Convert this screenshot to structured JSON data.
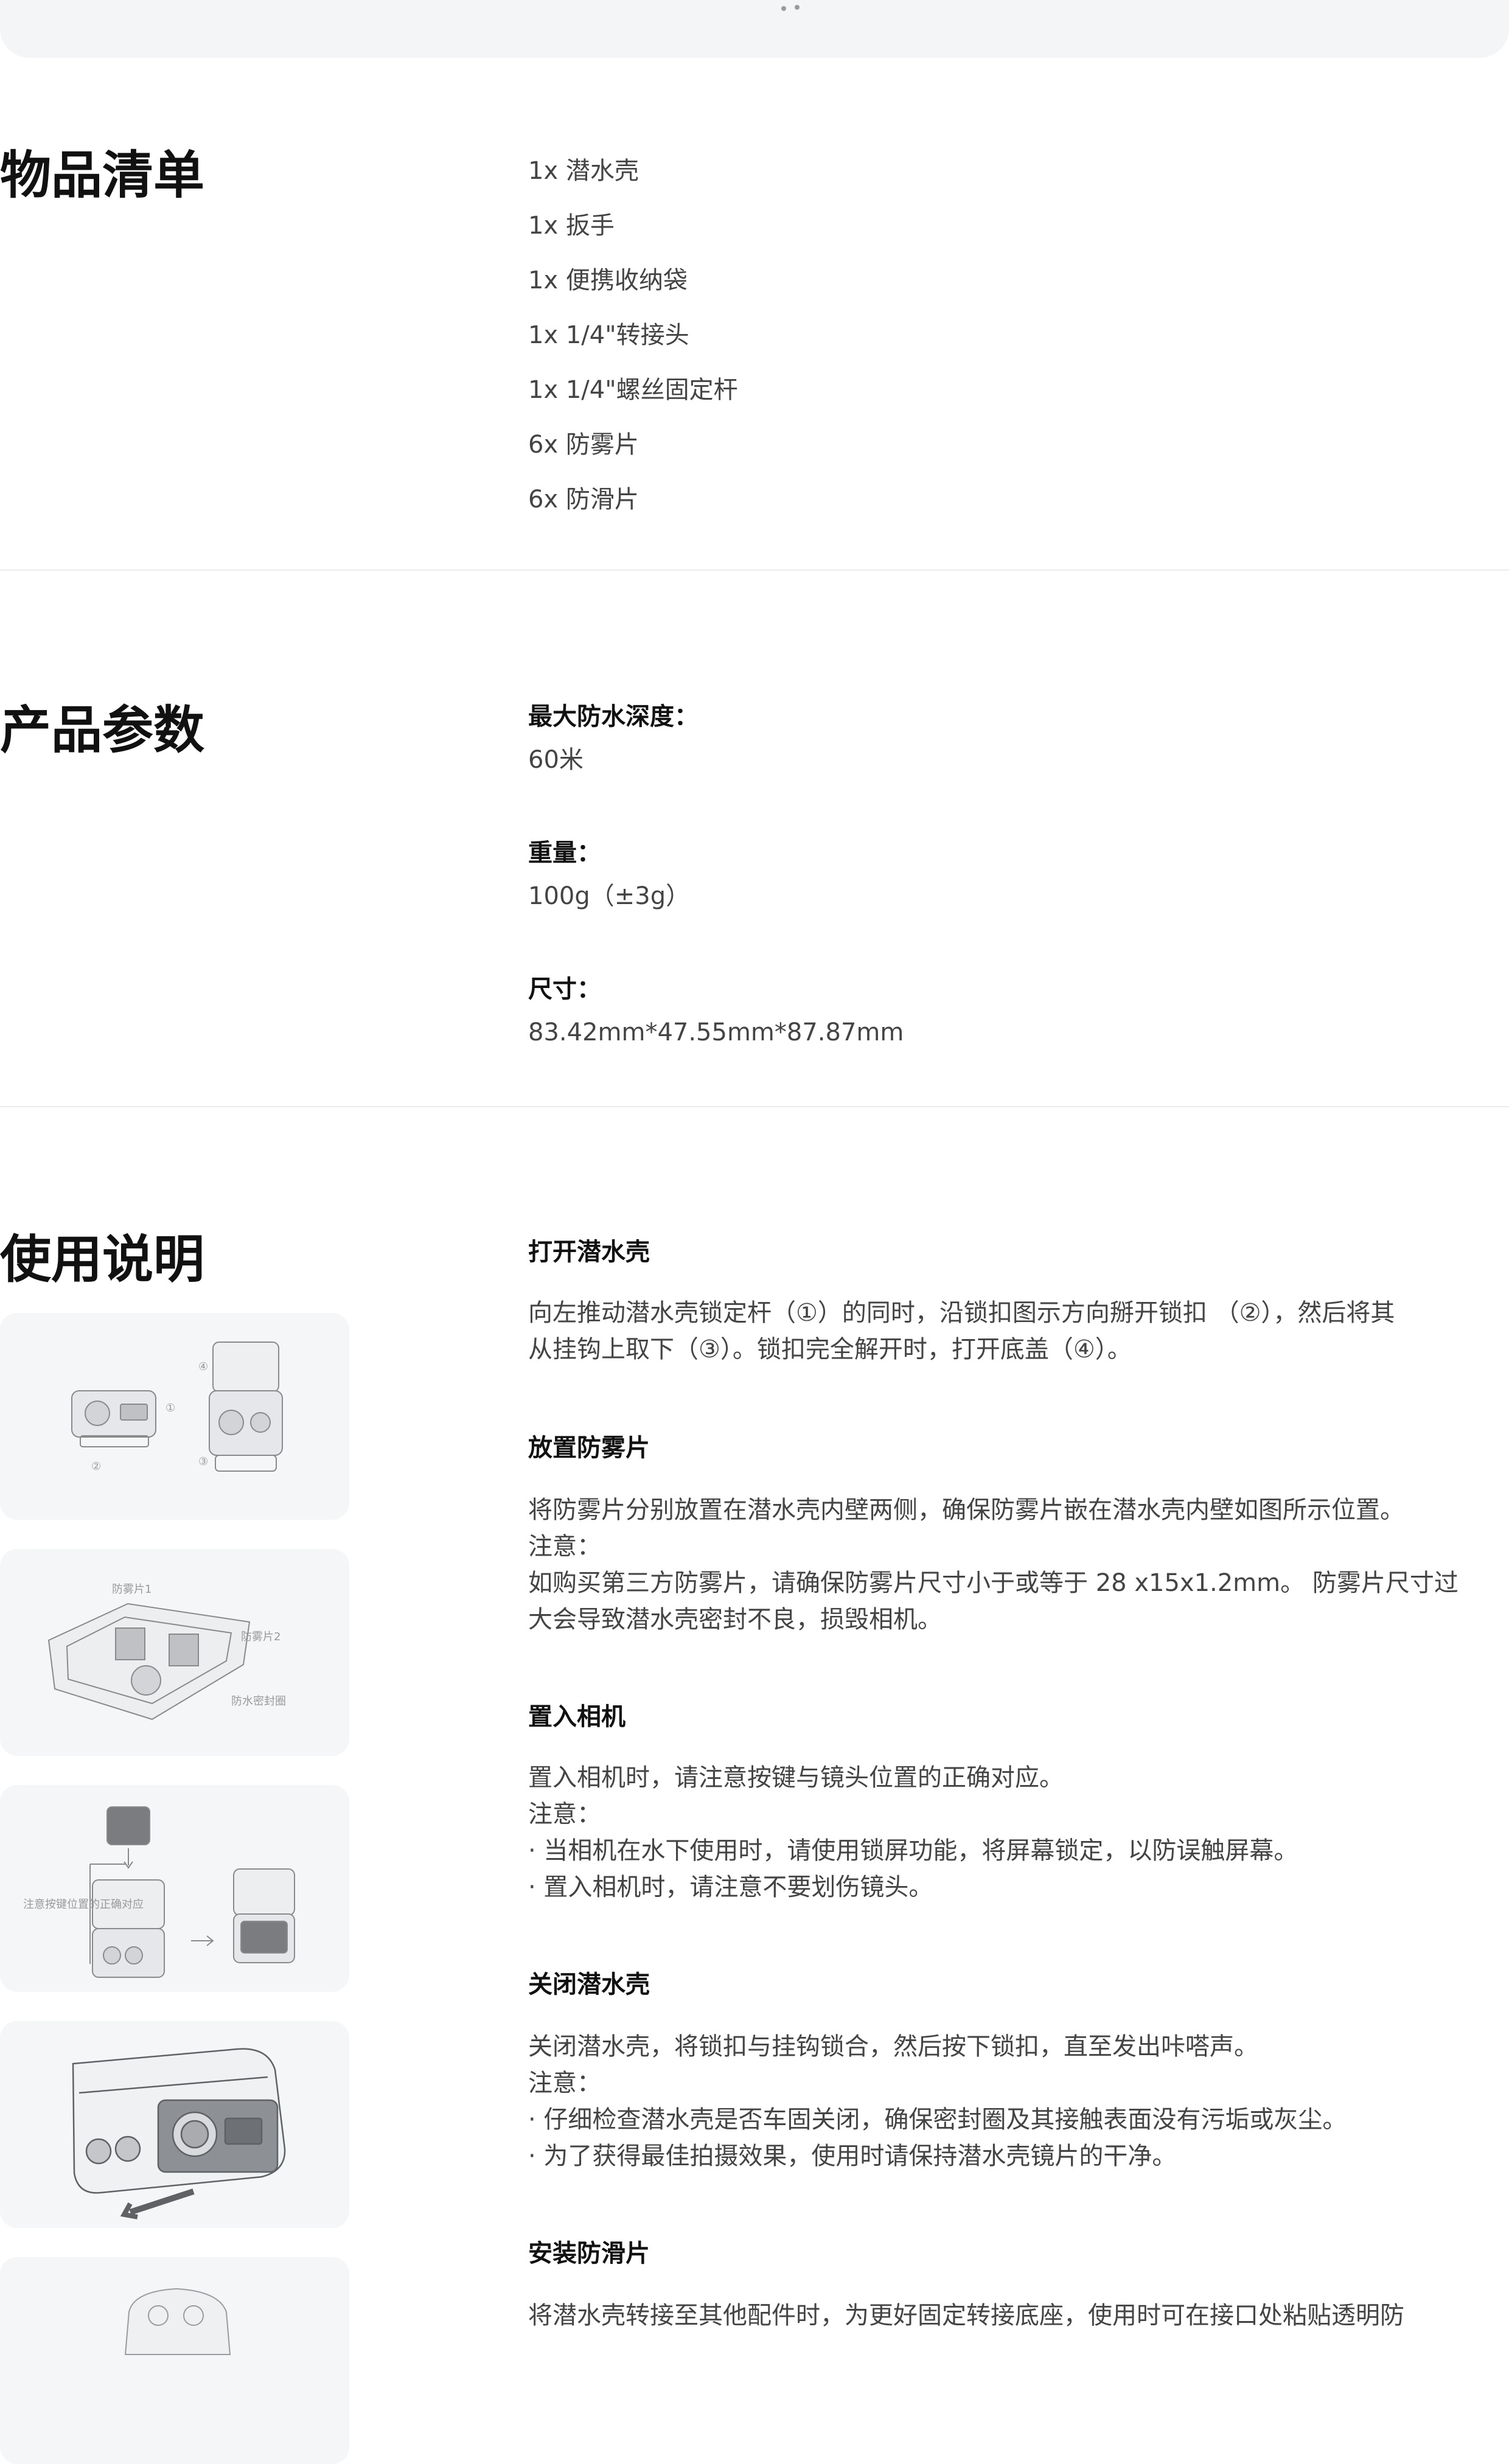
{
  "items_section": {
    "title": "物品清单",
    "items": [
      "1x 潜水壳",
      "1x 扳手",
      "1x 便携收纳袋",
      "1x 1/4\"转接头",
      "1x 1/4\"螺丝固定杆",
      "6x 防雾片",
      "6x 防滑片"
    ]
  },
  "params_section": {
    "title": "产品参数",
    "params": [
      {
        "label": "最大防水深度：",
        "value": "60米"
      },
      {
        "label": "重量：",
        "value": "100g（±3g）"
      },
      {
        "label": "尺寸：",
        "value": "83.42mm*47.55mm*87.87mm"
      }
    ]
  },
  "usage_section": {
    "title": "使用说明",
    "steps": [
      {
        "title": "打开潜水壳",
        "lines": [
          "向左推动潜水壳锁定杆（①）的同时，沿锁扣图示方向掰开锁扣 （②），然后将其",
          "从挂钩上取下（③）。锁扣完全解开时，打开底盖（④）。"
        ]
      },
      {
        "title": "放置防雾片",
        "lines": [
          "将防雾片分别放置在潜水壳内壁两侧，确保防雾片嵌在潜水壳内壁如图所示位置。",
          "注意：",
          "如购买第三方防雾片，请确保防雾片尺寸小于或等于 28 x15x1.2mm。 防雾片尺寸过",
          "大会导致潜水壳密封不良，损毁相机。"
        ]
      },
      {
        "title": "置入相机",
        "lines": [
          "置入相机时，请注意按键与镜头位置的正确对应。",
          "注意：",
          "· 当相机在水下使用时，请使用锁屏功能，将屏幕锁定，以防误触屏幕。",
          "· 置入相机时，请注意不要划伤镜头。"
        ]
      },
      {
        "title": "关闭潜水壳",
        "lines": [
          "关闭潜水壳，将锁扣与挂钩锁合，然后按下锁扣，直至发出咔嗒声。",
          "注意：",
          "· 仔细检查潜水壳是否车固关闭，确保密封圈及其接触表面没有污垢或灰尘。",
          "· 为了获得最佳拍摄效果，使用时请保持潜水壳镜片的干净。"
        ]
      },
      {
        "title": "安装防滑片",
        "lines": [
          "将潜水壳转接至其他配件时，为更好固定转接底座，使用时可在接口处粘贴透明防"
        ]
      }
    ],
    "illustrations": {
      "open_markers": [
        "①",
        "②",
        "③",
        "④"
      ],
      "antifog_labels": [
        "防雾片1",
        "防雾片2",
        "防水密封圈"
      ],
      "camera_label": "注意按键位置的正确对应"
    }
  },
  "colors": {
    "heading": "#111111",
    "text": "#444444",
    "card_bg": "#f5f6f8",
    "divider": "#ebebeb"
  }
}
